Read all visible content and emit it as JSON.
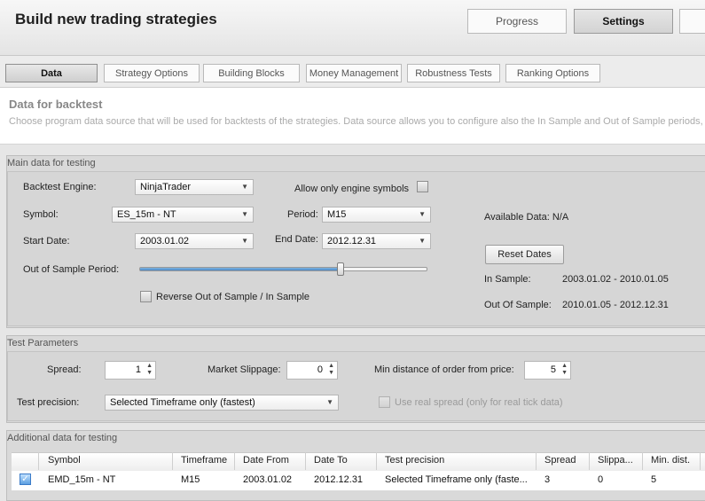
{
  "header": {
    "title": "Build new trading strategies",
    "progress_label": "Progress",
    "settings_label": "Settings"
  },
  "tabs": [
    {
      "label": "Data",
      "active": true
    },
    {
      "label": "Strategy Options",
      "active": false
    },
    {
      "label": "Building Blocks",
      "active": false
    },
    {
      "label": "Money Management",
      "active": false
    },
    {
      "label": "Robustness Tests",
      "active": false
    },
    {
      "label": "Ranking Options",
      "active": false
    }
  ],
  "section": {
    "title": "Data for backtest",
    "description": "Choose program data source that will be used for backtests of the strategies. Data source allows you to configure also the In Sample and Out of Sample periods, fo"
  },
  "main_data": {
    "group_title": "Main data for testing",
    "backtest_engine_label": "Backtest Engine:",
    "backtest_engine_value": "NinjaTrader",
    "allow_only_engine_symbols_label": "Allow only engine symbols",
    "allow_only_engine_symbols_checked": false,
    "symbol_label": "Symbol:",
    "symbol_value": "ES_15m - NT",
    "period_label": "Period:",
    "period_value": "M15",
    "available_data_label": "Available Data:",
    "available_data_value": "N/A",
    "start_date_label": "Start Date:",
    "start_date_value": "2003.01.02",
    "end_date_label": "End Date:",
    "end_date_value": "2012.12.31",
    "reset_dates_label": "Reset Dates",
    "oos_period_label": "Out of Sample Period:",
    "oos_slider_fraction": 0.7,
    "in_sample_label": "In Sample:",
    "in_sample_value": "2003.01.02 - 2010.01.05",
    "out_of_sample_label": "Out Of Sample:",
    "out_of_sample_value": "2010.01.05 - 2012.12.31",
    "reverse_label": "Reverse Out of Sample / In Sample",
    "reverse_checked": false
  },
  "test_params": {
    "group_title": "Test Parameters",
    "spread_label": "Spread:",
    "spread_value": "1",
    "slippage_label": "Market Slippage:",
    "slippage_value": "0",
    "min_distance_label": "Min distance of order from price:",
    "min_distance_value": "5",
    "precision_label": "Test precision:",
    "precision_value": "Selected Timeframe only (fastest)",
    "use_real_spread_label": "Use real spread (only for real tick data)"
  },
  "additional_data": {
    "group_title": "Additional data for testing",
    "columns": [
      "Symbol",
      "Timeframe",
      "Date From",
      "Date To",
      "Test precision",
      "Spread",
      "Slippa...",
      "Min. dist."
    ],
    "rows": [
      {
        "checked": true,
        "cells": [
          "EMD_15m - NT",
          "M15",
          "2003.01.02",
          "2012.12.31",
          "Selected Timeframe only (faste...",
          "3",
          "0",
          "5"
        ]
      }
    ]
  },
  "icons": {
    "dropdown": "chevron-down-icon",
    "spinner": "spinner-arrows-icon",
    "check": "checkmark-icon"
  },
  "colors": {
    "accent": "#4a87c6",
    "panel": "#d6d6d6"
  }
}
